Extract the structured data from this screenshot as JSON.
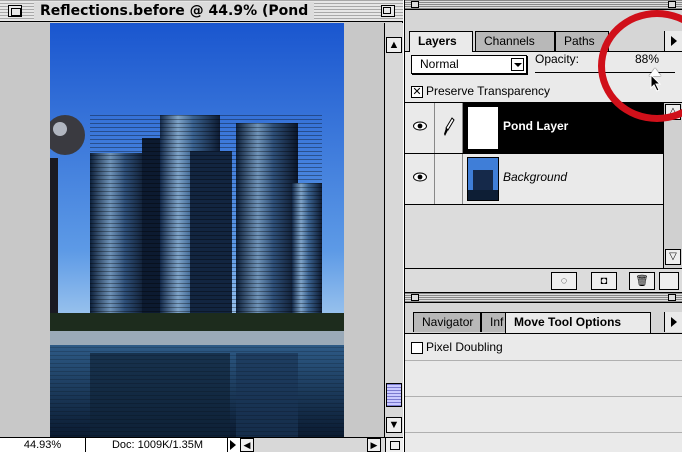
{
  "document": {
    "title": "Reflections.before @ 44.9% (Pond",
    "zoom_field": "44.93%",
    "doc_size": "Doc: 1009K/1.35M"
  },
  "layers_palette": {
    "tabs": [
      {
        "label": "Layers",
        "active": true
      },
      {
        "label": "Channels",
        "active": false
      },
      {
        "label": "Paths",
        "active": false
      }
    ],
    "blend_mode": "Normal",
    "opacity_label": "Opacity:",
    "opacity_value": "88%",
    "opacity_fraction": 0.88,
    "preserve_transparency": {
      "label": "Preserve Transparency",
      "checked": true
    },
    "layers": [
      {
        "name": "Pond Layer",
        "selected": true,
        "visible": true,
        "brush": true,
        "thumb": "white"
      },
      {
        "name": "Background",
        "selected": false,
        "visible": true,
        "brush": false,
        "thumb": "photo"
      }
    ]
  },
  "tool_palette": {
    "tabs": [
      {
        "label": "Navigator",
        "active": false
      },
      {
        "label": "Inf",
        "active": false
      },
      {
        "label": "Move Tool Options",
        "active": true
      }
    ],
    "pixel_doubling": {
      "label": "Pixel Doubling",
      "checked": false
    }
  },
  "colors": {
    "annotation": "#d0101a",
    "selection": "#000000",
    "sky_top": "#1e5fd8",
    "sky_bottom": "#a9cdef"
  },
  "icons": [
    "close-box-icon",
    "zoom-box-icon",
    "eye-icon",
    "brush-icon",
    "new-layer-icon",
    "mask-icon",
    "trash-icon",
    "cursor-arrow-icon"
  ]
}
